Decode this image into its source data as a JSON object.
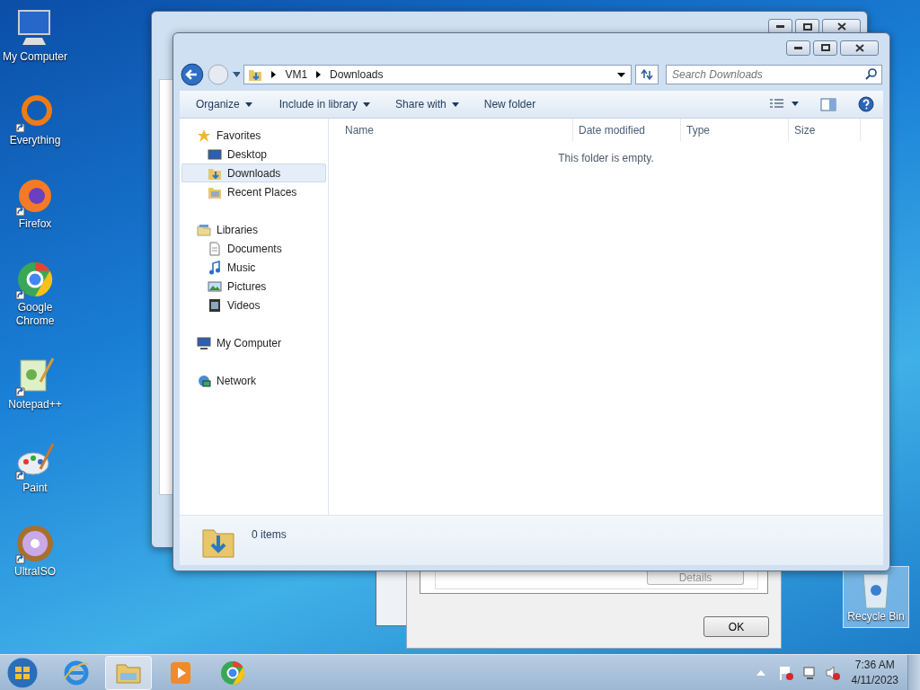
{
  "desktop_icons": [
    {
      "label": "My Computer",
      "kind": "computer",
      "shortcut": false
    },
    {
      "label": "Everything",
      "kind": "ring",
      "shortcut": true
    },
    {
      "label": "Firefox",
      "kind": "firefox",
      "shortcut": true
    },
    {
      "label": "Google Chrome",
      "kind": "chrome",
      "shortcut": true
    },
    {
      "label": "Notepad++",
      "kind": "notepad",
      "shortcut": true
    },
    {
      "label": "Paint",
      "kind": "paint",
      "shortcut": true
    },
    {
      "label": "UltraISO",
      "kind": "disc",
      "shortcut": true
    }
  ],
  "recycle_bin": {
    "label": "Recycle Bin",
    "selected": true
  },
  "dialog": {
    "details_button": {
      "label": "Details",
      "disabled": true
    },
    "ok_button": "OK"
  },
  "explorer": {
    "breadcrumb": [
      "VM1",
      "Downloads"
    ],
    "search": {
      "placeholder": "Search Downloads"
    },
    "toolbar": [
      {
        "label": "Organize",
        "dropdown": true
      },
      {
        "label": "Include in library",
        "dropdown": true
      },
      {
        "label": "Share with",
        "dropdown": true
      },
      {
        "label": "New folder",
        "dropdown": false
      }
    ],
    "nav": [
      {
        "label": "Favorites",
        "kind": "star",
        "selected": false,
        "children": [
          {
            "label": "Desktop",
            "kind": "desktop",
            "selected": false
          },
          {
            "label": "Downloads",
            "kind": "downloads",
            "selected": true
          },
          {
            "label": "Recent Places",
            "kind": "recent",
            "selected": false
          }
        ]
      },
      {
        "label": "Libraries",
        "kind": "library",
        "selected": false,
        "children": [
          {
            "label": "Documents",
            "kind": "document",
            "selected": false
          },
          {
            "label": "Music",
            "kind": "music",
            "selected": false
          },
          {
            "label": "Pictures",
            "kind": "picture",
            "selected": false
          },
          {
            "label": "Videos",
            "kind": "video",
            "selected": false
          }
        ]
      },
      {
        "label": "My Computer",
        "kind": "computer",
        "selected": false
      },
      {
        "label": "Network",
        "kind": "network",
        "selected": false
      }
    ],
    "columns": [
      "Name",
      "Date modified",
      "Type",
      "Size"
    ],
    "empty_text": "This folder is empty.",
    "status": "0 items"
  },
  "taskbar": {
    "items": [
      {
        "kind": "ie",
        "active": false
      },
      {
        "kind": "explorer",
        "active": true
      },
      {
        "kind": "media",
        "active": false
      },
      {
        "kind": "chrome",
        "active": false
      }
    ],
    "time": "7:36 AM",
    "date": "4/11/2023"
  }
}
